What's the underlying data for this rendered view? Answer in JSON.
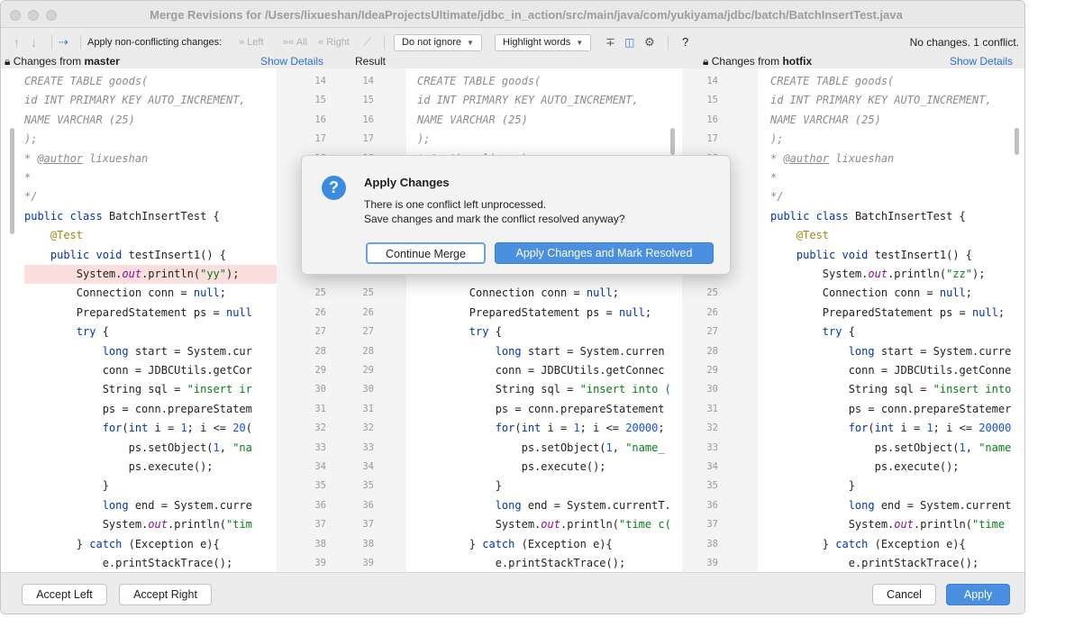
{
  "window": {
    "title": "Merge Revisions for /Users/lixueshan/IdeaProjectsUltimate/jdbc_in_action/src/main/java/com/yukiyama/jdbc/batch/BatchInsertTest.java"
  },
  "toolbar": {
    "apply_non_conflicting_label": "Apply non-conflicting changes:",
    "left_label": "Left",
    "all_label": "All",
    "right_label": "Right",
    "ignore_dropdown": "Do not ignore",
    "highlight_dropdown": "Highlight words",
    "help_label": "?",
    "status": "No changes. 1 conflict."
  },
  "panes": {
    "left_header_prefix": "Changes from",
    "left_branch": "master",
    "left_show_details": "Show Details",
    "result_label": "Result",
    "right_header_prefix": "Changes from",
    "right_branch": "hotfix",
    "right_show_details": "Show Details"
  },
  "gutters": {
    "left_numbers": [
      "14",
      "15",
      "16",
      "17",
      "18",
      "",
      "",
      "",
      "",
      "",
      "",
      "25",
      "26",
      "27",
      "28",
      "29",
      "30",
      "31",
      "32",
      "33",
      "34",
      "35",
      "36",
      "37",
      "38",
      "39"
    ],
    "result_numbers": [
      "14",
      "15",
      "16",
      "17",
      "18",
      "",
      "",
      "",
      "",
      "",
      "",
      "25",
      "26",
      "27",
      "28",
      "29",
      "30",
      "31",
      "32",
      "33",
      "34",
      "35",
      "36",
      "37",
      "38",
      "39"
    ],
    "right_numbers": [
      "14",
      "15",
      "16",
      "17",
      "18",
      "",
      "",
      "",
      "",
      "",
      "",
      "25",
      "26",
      "27",
      "28",
      "29",
      "30",
      "31",
      "32",
      "33",
      "34",
      "35",
      "36",
      "37",
      "38",
      "39"
    ]
  },
  "code": {
    "left": [
      "CREATE TABLE goods(",
      "id INT PRIMARY KEY AUTO_INCREMENT,",
      "NAME VARCHAR (25)",
      ");",
      "* @author lixueshan",
      "*",
      "*/",
      "public class BatchInsertTest {",
      "    @Test",
      "    public void testInsert1() {",
      "        System.out.println(\"yy\");",
      "        Connection conn = null;",
      "        PreparedStatement ps = null",
      "        try {",
      "            long start = System.cur",
      "            conn = JDBCUtils.getCor",
      "            String sql = \"insert ir",
      "            ps = conn.prepareStatem",
      "            for(int i = 1; i <= 20(",
      "                ps.setObject(1, \"na",
      "                ps.execute();",
      "            }",
      "            long end = System.curre",
      "            System.out.println(\"tim",
      "        } catch (Exception e){",
      "            e.printStackTrace();"
    ],
    "result": [
      "CREATE TABLE goods(",
      "id INT PRIMARY KEY AUTO_INCREMENT,",
      "NAME VARCHAR (25)",
      ");",
      "* @author lixueshan",
      "",
      "",
      "",
      "",
      "",
      "",
      "        Connection conn = null;",
      "        PreparedStatement ps = null;",
      "        try {",
      "            long start = System.curren",
      "            conn = JDBCUtils.getConnec",
      "            String sql = \"insert into (",
      "            ps = conn.prepareStatement",
      "            for(int i = 1; i <= 20000;",
      "                ps.setObject(1, \"name_",
      "                ps.execute();",
      "            }",
      "            long end = System.currentT.",
      "            System.out.println(\"time c(",
      "        } catch (Exception e){",
      "            e.printStackTrace();"
    ],
    "right": [
      "CREATE TABLE goods(",
      "id INT PRIMARY KEY AUTO_INCREMENT,",
      "NAME VARCHAR (25)",
      ");",
      "* @author lixueshan",
      "*",
      "*/",
      "public class BatchInsertTest {",
      "    @Test",
      "    public void testInsert1() {",
      "        System.out.println(\"zz\");",
      "        Connection conn = null;",
      "        PreparedStatement ps = null;",
      "        try {",
      "            long start = System.curre",
      "            conn = JDBCUtils.getConne",
      "            String sql = \"insert into",
      "            ps = conn.prepareStatemer",
      "            for(int i = 1; i <= 20000",
      "                ps.setObject(1, \"name",
      "                ps.execute();",
      "            }",
      "            long end = System.current",
      "            System.out.println(\"time",
      "        } catch (Exception e){",
      "            e.printStackTrace();"
    ]
  },
  "dialog": {
    "title": "Apply Changes",
    "message_line1": "There is one conflict left unprocessed.",
    "message_line2": "Save changes and mark the conflict resolved anyway?",
    "continue_label": "Continue Merge",
    "apply_label": "Apply Changes and Mark Resolved",
    "icon": "question-icon"
  },
  "footer": {
    "accept_left": "Accept Left",
    "accept_right": "Accept Right",
    "cancel": "Cancel",
    "apply": "Apply"
  },
  "colors": {
    "accent": "#4a8fe0",
    "conflict": "#fcdede",
    "keyword": "#0033b3",
    "string": "#067d17"
  }
}
